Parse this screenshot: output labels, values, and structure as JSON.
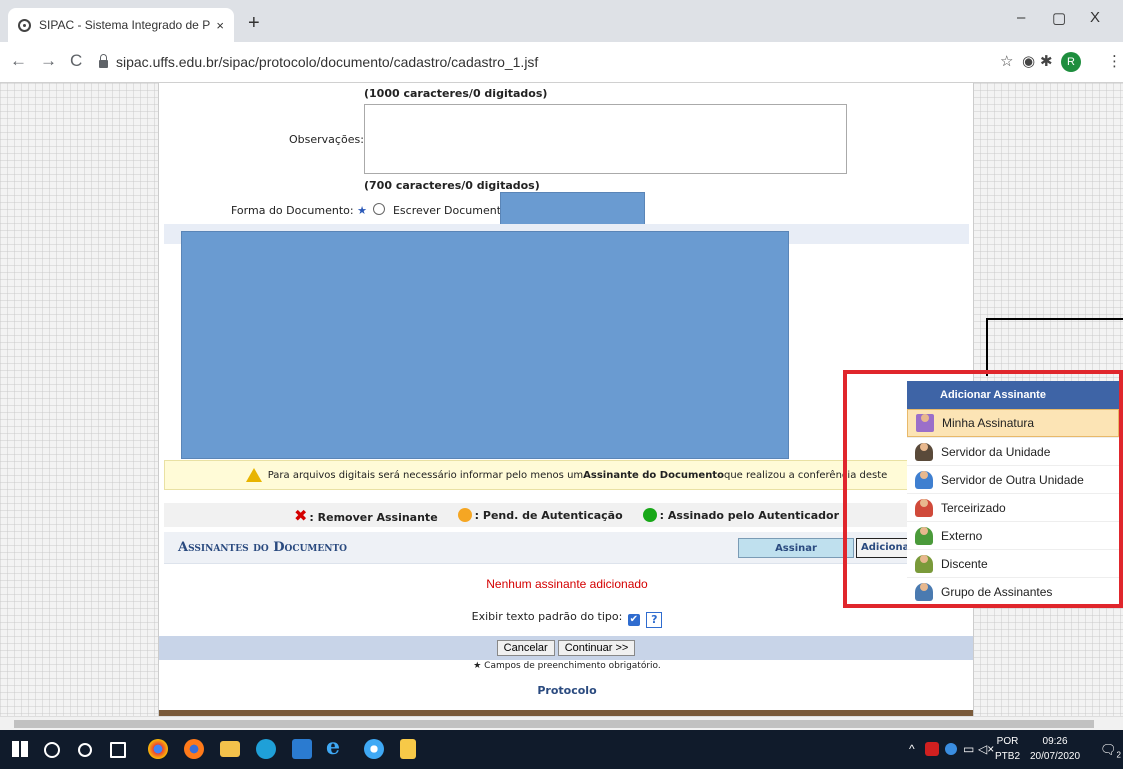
{
  "browser": {
    "tab_title": "SIPAC - Sistema Integrado de Pat",
    "tab_close": "×",
    "new_tab": "+",
    "url": "sipac.uffs.edu.br/sipac/protocolo/documento/cadastro/cadastro_1.jsf",
    "back": "←",
    "forward": "→",
    "reload": "C",
    "minimize": "–",
    "maximize": "▢",
    "close": "X",
    "profile_initial": "R",
    "star": "☆",
    "ext1": "◉",
    "ext2": "✱",
    "menu": "⋮"
  },
  "form": {
    "chars_top": "(1000 caracteres/0 digitados)",
    "observacoes_label": "Observações:",
    "chars_obs": "(700 caracteres/0 digitados)",
    "forma_label": "Forma do Documento:",
    "required_mark": "★",
    "escrever_option": "Escrever Documento",
    "warning_text_pre": "Para arquivos digitais será necessário informar pelo menos um ",
    "warning_text_bold": "Assinante do Documento",
    "warning_text_post": " que realizou a conferência deste",
    "legend_remove": ": Remover Assinante",
    "legend_pending": ": Pend. de Autenticação",
    "legend_signed": ": Assinado pelo Autenticador",
    "signers_header": "Assinantes do Documento",
    "assinar_button": "Assinar",
    "adicionar_button": "Adicionar",
    "no_signer": "Nenhum assinante adicionado",
    "exibir_label": "Exibir texto padrão do tipo:",
    "checkbox_mark": "✔",
    "help_mark": "?",
    "cancel_button": "Cancelar",
    "continue_button": "Continuar >>",
    "required_note": "★ Campos de preenchimento obrigatório.",
    "footer_link": "Protocolo"
  },
  "menu": {
    "title": "Adicionar Assinante",
    "items": [
      {
        "label": "Minha Assinatura",
        "icon": "signature-icon"
      },
      {
        "label": "Servidor da Unidade",
        "icon": "user-icon"
      },
      {
        "label": "Servidor de Outra Unidade",
        "icon": "user-other-icon"
      },
      {
        "label": "Terceirizado",
        "icon": "contractor-icon"
      },
      {
        "label": "Externo",
        "icon": "external-user-icon"
      },
      {
        "label": "Discente",
        "icon": "student-icon"
      },
      {
        "label": "Grupo de Assinantes",
        "icon": "group-icon"
      }
    ]
  },
  "taskbar": {
    "lang_top": "POR",
    "lang_bottom": "PTB2",
    "time": "09:26",
    "date": "20/07/2020",
    "notif_count": "2"
  },
  "colors": {
    "redacted_block": "#6a9bd1",
    "highlight_box": "#e0262c",
    "menu_header": "#3e64a6",
    "pending_dot": "#f5a623",
    "signed_dot": "#18a818"
  }
}
